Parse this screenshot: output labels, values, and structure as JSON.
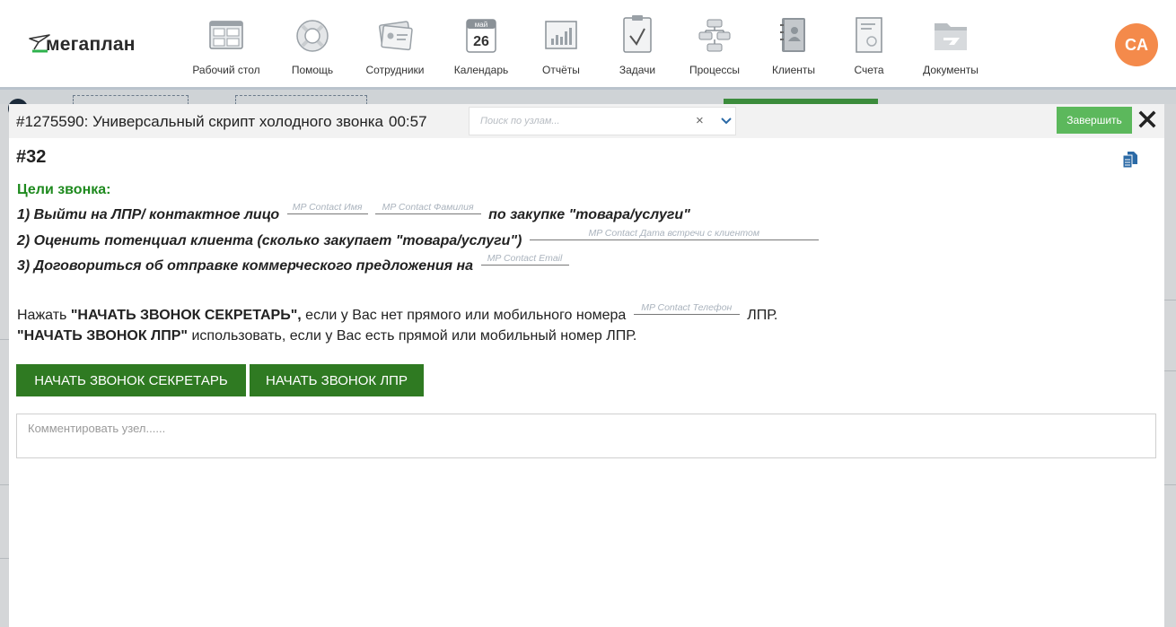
{
  "logo": {
    "text": "мегаплан"
  },
  "nav": [
    {
      "label": "Рабочий стол",
      "icon": "dashboard-icon"
    },
    {
      "label": "Помощь",
      "icon": "lifebuoy-icon"
    },
    {
      "label": "Сотрудники",
      "icon": "employees-icon"
    },
    {
      "label": "Календарь",
      "icon": "calendar-icon",
      "month": "май",
      "day": "26"
    },
    {
      "label": "Отчёты",
      "icon": "reports-icon"
    },
    {
      "label": "Задачи",
      "icon": "tasks-icon"
    },
    {
      "label": "Процессы",
      "icon": "processes-icon"
    },
    {
      "label": "Клиенты",
      "icon": "clients-icon"
    },
    {
      "label": "Счета",
      "icon": "invoices-icon"
    },
    {
      "label": "Документы",
      "icon": "documents-icon"
    }
  ],
  "user": {
    "initials": "CA",
    "color": "#f48a4b"
  },
  "modal": {
    "title": "#1275590: Универсальный скрипт холодного звонка",
    "timer": "00:57",
    "search_placeholder": "Поиск по узлам...",
    "search_clear": "×",
    "finish_label": "Завершить",
    "node_number": "#32",
    "goals_title": "Цели звонка:",
    "goal1": {
      "before": "1) Выйти на ЛПР/ контактное лицо",
      "field1": "MP Contact Имя",
      "field2": "MP Contact Фамилия",
      "after": "по закупке \"товара/услуги\""
    },
    "goal2": {
      "before": "2) Оценить потенциал клиента (сколько закупает \"товара/услуги\")",
      "field": "MP Contact Дата встречи с клиентом"
    },
    "goal3": {
      "before": "3) Договориться об отправке коммерческого предложения на",
      "field": "MP Contact Email"
    },
    "instr1": {
      "part1": "Нажать",
      "bold1": "\"НАЧАТЬ ЗВОНОК СЕКРЕТАРЬ\",",
      "part2": "если у Вас нет прямого или мобильного номера",
      "field": "MP Contact Телефон",
      "part3": "ЛПР."
    },
    "instr2": {
      "bold1": "\"НАЧАТЬ ЗВОНОК ЛПР\"",
      "part2": "использовать, если у Вас есть прямой или мобильный номер ЛПР."
    },
    "btn_secretary": "НАЧАТЬ ЗВОНОК СЕКРЕТАРЬ",
    "btn_lpr": "НАЧАТЬ ЗВОНОК ЛПР",
    "comment_placeholder": "Комментировать узел......"
  },
  "colors": {
    "accent_green": "#2f7a22",
    "finish_green": "#5cb85c",
    "goals_green": "#1e8a1e",
    "icon_blue": "#2b6aa6"
  }
}
